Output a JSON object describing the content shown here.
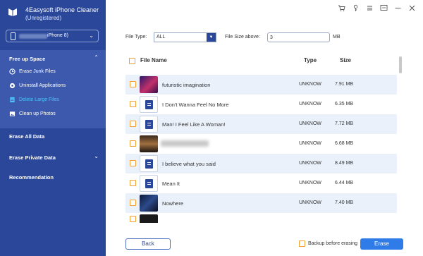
{
  "app": {
    "title": "4Easysoft iPhone Cleaner",
    "subtitle": "(Unregistered)"
  },
  "device": {
    "name": "iPhone 8)"
  },
  "sidebar": {
    "free_up_space": {
      "label": "Free up Space",
      "items": [
        {
          "label": "Erase Junk Files",
          "icon": "clock-icon"
        },
        {
          "label": "Uninstall Applications",
          "icon": "app-icon"
        },
        {
          "label": "Delete Large Files",
          "icon": "file-icon",
          "active": true
        },
        {
          "label": "Clean up Photos",
          "icon": "photo-icon"
        }
      ]
    },
    "erase_all": "Erase All Data",
    "erase_private": "Erase Private Data",
    "recommendation": "Recommendation"
  },
  "filters": {
    "file_type_label": "File Type:",
    "file_type_value": "ALL",
    "size_label": "File Size above:",
    "size_value": "3",
    "size_unit": "MB"
  },
  "table": {
    "headers": {
      "name": "File Name",
      "type": "Type",
      "size": "Size"
    },
    "rows": [
      {
        "name": "futuristic imagination",
        "type": "UNKNOW",
        "size": "7.91 MB",
        "thumb": "image"
      },
      {
        "name": "I Don't Wanna Feel No More",
        "type": "UNKNOW",
        "size": "6.35 MB",
        "thumb": "doc"
      },
      {
        "name": "Man! I Feel Like A Woman!",
        "type": "UNKNOW",
        "size": "7.72 MB",
        "thumb": "doc"
      },
      {
        "name": "",
        "type": "UNKNOW",
        "size": "6.68 MB",
        "thumb": "image"
      },
      {
        "name": "I believe what you said",
        "type": "UNKNOW",
        "size": "8.49 MB",
        "thumb": "doc"
      },
      {
        "name": "Mean It",
        "type": "UNKNOW",
        "size": "6.44 MB",
        "thumb": "doc"
      },
      {
        "name": "Nowhere",
        "type": "UNKNOW",
        "size": "7.40 MB",
        "thumb": "image"
      }
    ]
  },
  "footer": {
    "back": "Back",
    "backup": "Backup before erasing",
    "erase": "Erase"
  },
  "colors": {
    "sidebar": "#2b4799",
    "accent": "#2f7ce8",
    "checkbox": "#f0a030",
    "active_nav": "#4fc3f7"
  }
}
